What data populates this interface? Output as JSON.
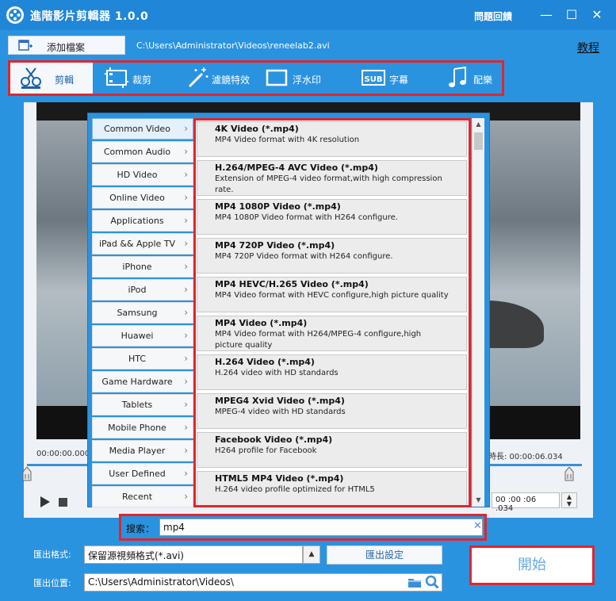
{
  "window": {
    "title": "進階影片剪輯器 1.0.0",
    "feedback": "問題回饋",
    "minimize": "—",
    "maximize": "☐",
    "close": "✕"
  },
  "file": {
    "add_label": "添加檔案",
    "path": "C:\\Users\\Administrator\\Videos\\reneelab2.avi",
    "tutorial": "教程"
  },
  "tabs": [
    {
      "label": "剪輯",
      "icon": "film-cut-icon",
      "active": true
    },
    {
      "label": "裁剪",
      "icon": "crop-icon",
      "active": false
    },
    {
      "label": "濾鏡特效",
      "icon": "magic-wand-icon",
      "active": false
    },
    {
      "label": "浮水印",
      "icon": "watermark-icon",
      "active": false
    },
    {
      "label": "字幕",
      "icon": "subtitle-icon",
      "active": false
    },
    {
      "label": "配樂",
      "icon": "music-note-icon",
      "active": false
    }
  ],
  "player": {
    "start_time": "00:00:00.000",
    "duration_label": "時長: 00:00:06.034",
    "time_field": "00 :00 :06 .034"
  },
  "categories": [
    "Common Video",
    "Common Audio",
    "HD Video",
    "Online Video",
    "Applications",
    "iPad && Apple TV",
    "iPhone",
    "iPod",
    "Samsung",
    "Huawei",
    "HTC",
    "Game Hardware",
    "Tablets",
    "Mobile Phone",
    "Media Player",
    "User Defined",
    "Recent"
  ],
  "active_category": "Common Video",
  "formats": [
    {
      "name": "4K Video (*.mp4)",
      "desc": "MP4 Video format with 4K resolution"
    },
    {
      "name": "H.264/MPEG-4 AVC Video (*.mp4)",
      "desc": "Extension of MPEG-4 video format,with high compression rate."
    },
    {
      "name": "MP4 1080P Video (*.mp4)",
      "desc": "MP4 1080P Video format with H264 configure."
    },
    {
      "name": "MP4 720P Video (*.mp4)",
      "desc": "MP4 720P Video format with H264 configure."
    },
    {
      "name": "MP4 HEVC/H.265 Video (*.mp4)",
      "desc": "MP4 Video format with HEVC configure,high picture quality"
    },
    {
      "name": "MP4 Video (*.mp4)",
      "desc": "MP4 Video format with H264/MPEG-4 configure,high picture quality"
    },
    {
      "name": "H.264 Video (*.mp4)",
      "desc": "H.264 video with HD standards"
    },
    {
      "name": "MPEG4 Xvid Video (*.mp4)",
      "desc": "MPEG-4 video with HD standards"
    },
    {
      "name": "Facebook Video (*.mp4)",
      "desc": "H264 profile for Facebook"
    },
    {
      "name": "HTML5 MP4 Video (*.mp4)",
      "desc": "H.264 video profile optimized for HTML5"
    }
  ],
  "search": {
    "label": "搜索：",
    "value": "mp4"
  },
  "output": {
    "format_label": "匯出格式:",
    "format_value": "保留源視頻格式(*.avi)",
    "settings_label": "匯出設定",
    "location_label": "匯出位置:",
    "location_value": "C:\\Users\\Administrator\\Videos\\",
    "start_label": "開始"
  }
}
